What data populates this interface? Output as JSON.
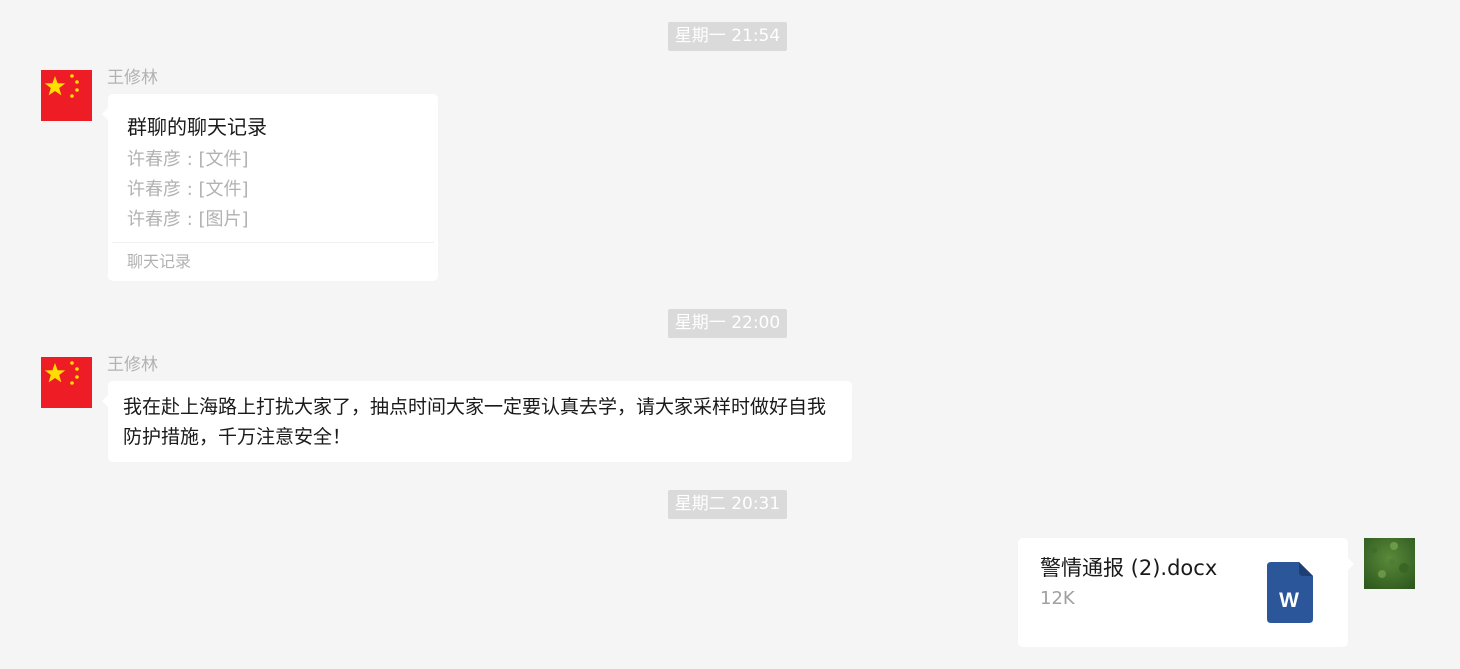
{
  "timestamps": [
    "星期一 21:54",
    "星期一 22:00",
    "星期二 20:31"
  ],
  "messages": {
    "m1": {
      "sender": "王修林",
      "title": "群聊的聊天记录",
      "lines": [
        "许春彦 : [文件]",
        "许春彦 : [文件]",
        "许春彦 : [图片]"
      ],
      "footer": "聊天记录"
    },
    "m2": {
      "sender": "王修林",
      "text": "我在赴上海路上打扰大家了，抽点时间大家一定要认真去学，请大家采样时做好自我防护措施，千万注意安全！"
    },
    "m3": {
      "file_name": "警情通报 (2).docx",
      "file_size": "12K",
      "file_icon_letter": "W"
    }
  },
  "colors": {
    "background": "#f5f5f5",
    "bubble": "#ffffff",
    "timestamp_bg": "#dadada",
    "word_icon": "#2b579a",
    "flag_red": "#ee1c25",
    "flag_star": "#ffde00"
  },
  "icons": {
    "sender_avatar": "china-flag-avatar",
    "self_avatar": "green-grass-avatar",
    "file": "word-document-icon"
  }
}
